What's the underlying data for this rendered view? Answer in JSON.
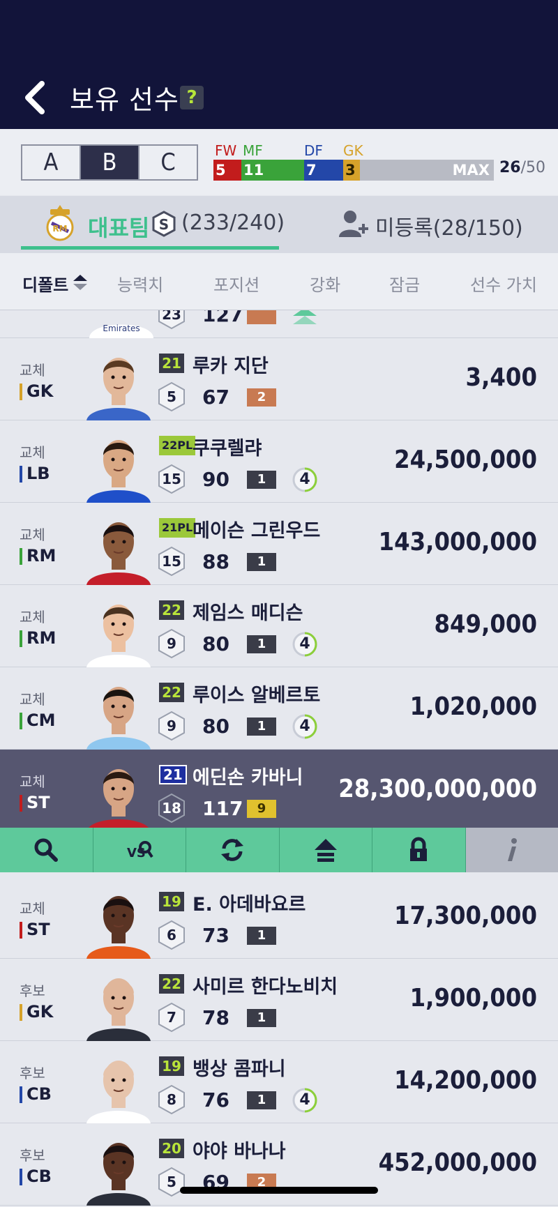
{
  "header": {
    "title": "보유 선수",
    "help_label": "?"
  },
  "squads": {
    "tabs": [
      "A",
      "B",
      "C"
    ],
    "active": "B"
  },
  "position_bar": {
    "labels": [
      {
        "name": "FW",
        "color": "#c21c1c"
      },
      {
        "name": "MF",
        "color": "#3aa33a"
      },
      {
        "name": "DF",
        "color": "#2347a8"
      },
      {
        "name": "GK",
        "color": "#d6a22a"
      }
    ],
    "values": {
      "fw": "5",
      "mf": "11",
      "df": "7",
      "gk": "3"
    },
    "max_label": "MAX",
    "count": "26",
    "capacity": "/50"
  },
  "team_tabs": {
    "main_label": "대표팀",
    "main_count": "(233/240)",
    "unreg_label": "미등록(28/150)"
  },
  "sort": {
    "items": [
      "디폴트",
      "능력치",
      "포지션",
      "강화",
      "잠금",
      "선수 가치"
    ]
  },
  "players": [
    {
      "role": "교체",
      "position": "GK",
      "pos_color": "#d6a22a",
      "season": "21",
      "season_style": "dark",
      "name": "루카 지단",
      "level": "5",
      "ovr": "67",
      "grade": "2",
      "chem": "",
      "value": "3,400",
      "skin": "#e2b89a",
      "hair": "#5a3a22",
      "shirt": "#3a66c8"
    },
    {
      "role": "교체",
      "position": "LB",
      "pos_color": "#2347a8",
      "season": "22PL",
      "season_style": "pl",
      "name": "쿠쿠렐랴",
      "level": "15",
      "ovr": "90",
      "grade": "1",
      "chem": "4",
      "value": "24,500,000",
      "skin": "#d9a884",
      "hair": "#2a1a10",
      "shirt": "#1f4fc9"
    },
    {
      "role": "교체",
      "position": "RM",
      "pos_color": "#3aa33a",
      "season": "21PL",
      "season_style": "pl",
      "name": "메이슨 그린우드",
      "level": "15",
      "ovr": "88",
      "grade": "1",
      "chem": "",
      "value": "143,000,000",
      "skin": "#8a5a3c",
      "hair": "#1a1010",
      "shirt": "#c41e2a"
    },
    {
      "role": "교체",
      "position": "RM",
      "pos_color": "#3aa33a",
      "season": "22",
      "season_style": "dark",
      "name": "제임스 매디슨",
      "level": "9",
      "ovr": "80",
      "grade": "1",
      "chem": "4",
      "value": "849,000",
      "skin": "#ecc0a0",
      "hair": "#4a3220",
      "shirt": "#ffffff"
    },
    {
      "role": "교체",
      "position": "CM",
      "pos_color": "#3aa33a",
      "season": "22",
      "season_style": "dark",
      "name": "루이스 알베르토",
      "level": "9",
      "ovr": "80",
      "grade": "1",
      "chem": "4",
      "value": "1,020,000",
      "skin": "#d7a585",
      "hair": "#1a1410",
      "shirt": "#8fc7ef"
    },
    {
      "role": "교체",
      "position": "ST",
      "pos_color": "#c21c1c",
      "season": "21",
      "season_style": "blue",
      "name": "에딘손 카바니",
      "level": "18",
      "ovr": "117",
      "grade": "9",
      "chem": "",
      "value": "28,300,000,000",
      "skin": "#d7a585",
      "hair": "#2a1a12",
      "shirt": "#c41e2a",
      "selected": true
    },
    {
      "role": "교체",
      "position": "ST",
      "pos_color": "#c21c1c",
      "season": "19",
      "season_style": "dark",
      "name": "E. 아데바요르",
      "level": "6",
      "ovr": "73",
      "grade": "1",
      "chem": "",
      "value": "17,300,000",
      "skin": "#5a3424",
      "hair": "#1a1010",
      "shirt": "#e65a1a"
    },
    {
      "role": "후보",
      "position": "GK",
      "pos_color": "#d6a22a",
      "season": "22",
      "season_style": "dark",
      "name": "사미르 한다노비치",
      "level": "7",
      "ovr": "78",
      "grade": "1",
      "chem": "",
      "value": "1,900,000",
      "skin": "#e0b69a",
      "hair": "#e0b69a",
      "shirt": "#2a2e3a"
    },
    {
      "role": "후보",
      "position": "CB",
      "pos_color": "#2347a8",
      "season": "19",
      "season_style": "dark",
      "name": "뱅상 콤파니",
      "level": "8",
      "ovr": "76",
      "grade": "1",
      "chem": "4",
      "value": "14,200,000",
      "skin": "#e6c4ac",
      "hair": "#e6c4ac",
      "shirt": "#ffffff"
    },
    {
      "role": "후보",
      "position": "CB",
      "pos_color": "#2347a8",
      "season": "20",
      "season_style": "dark",
      "name": "야야 바나나",
      "level": "5",
      "ovr": "69",
      "grade": "2",
      "chem": "",
      "value": "452,000,000",
      "skin": "#5a3424",
      "hair": "#1a1010",
      "shirt": "#2a2e3a"
    }
  ],
  "partial_top_row": {
    "level": "23",
    "ovr": "127",
    "sponsor": "Emirates"
  },
  "actions": [
    "search-icon",
    "compare-icon",
    "refresh-icon",
    "upgrade-icon",
    "lock-icon",
    "info-icon"
  ]
}
